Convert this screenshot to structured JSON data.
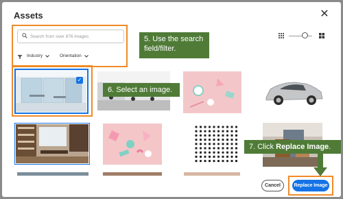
{
  "dialog": {
    "title": "Assets",
    "close_icon": "close-icon"
  },
  "search": {
    "placeholder": "Search from over 876 images",
    "value": "",
    "icon": "search-icon"
  },
  "filters": {
    "icon": "filter-icon",
    "industry_label": "Industry",
    "orientation_label": "Orientation"
  },
  "view": {
    "grid_icon": "grid-view-icon",
    "list_icon": "list-view-icon"
  },
  "callouts": {
    "step5": "5. Use the search field/filter.",
    "step6": "6. Select an image.",
    "step7_prefix": "7. Click ",
    "step7_bold": "Replace Image",
    "step7_suffix": "."
  },
  "footer": {
    "cancel_label": "Cancel",
    "replace_label": "Replace Image"
  },
  "images": [
    {
      "name": "glass-office",
      "selected": true
    },
    {
      "name": "open-office-desks",
      "selected": false
    },
    {
      "name": "pink-shapes-stationery",
      "selected": false
    },
    {
      "name": "silver-hatchback-car",
      "selected": false
    },
    {
      "name": "library-office-room",
      "selected": false
    },
    {
      "name": "pink-3d-shapes",
      "selected": false
    },
    {
      "name": "icon-grid-sheet",
      "selected": false
    },
    {
      "name": "person-with-bag",
      "selected": false
    }
  ],
  "colors": {
    "accent": "#1473e6",
    "callout_bg": "#4f7b37",
    "highlight": "#f08a28"
  }
}
